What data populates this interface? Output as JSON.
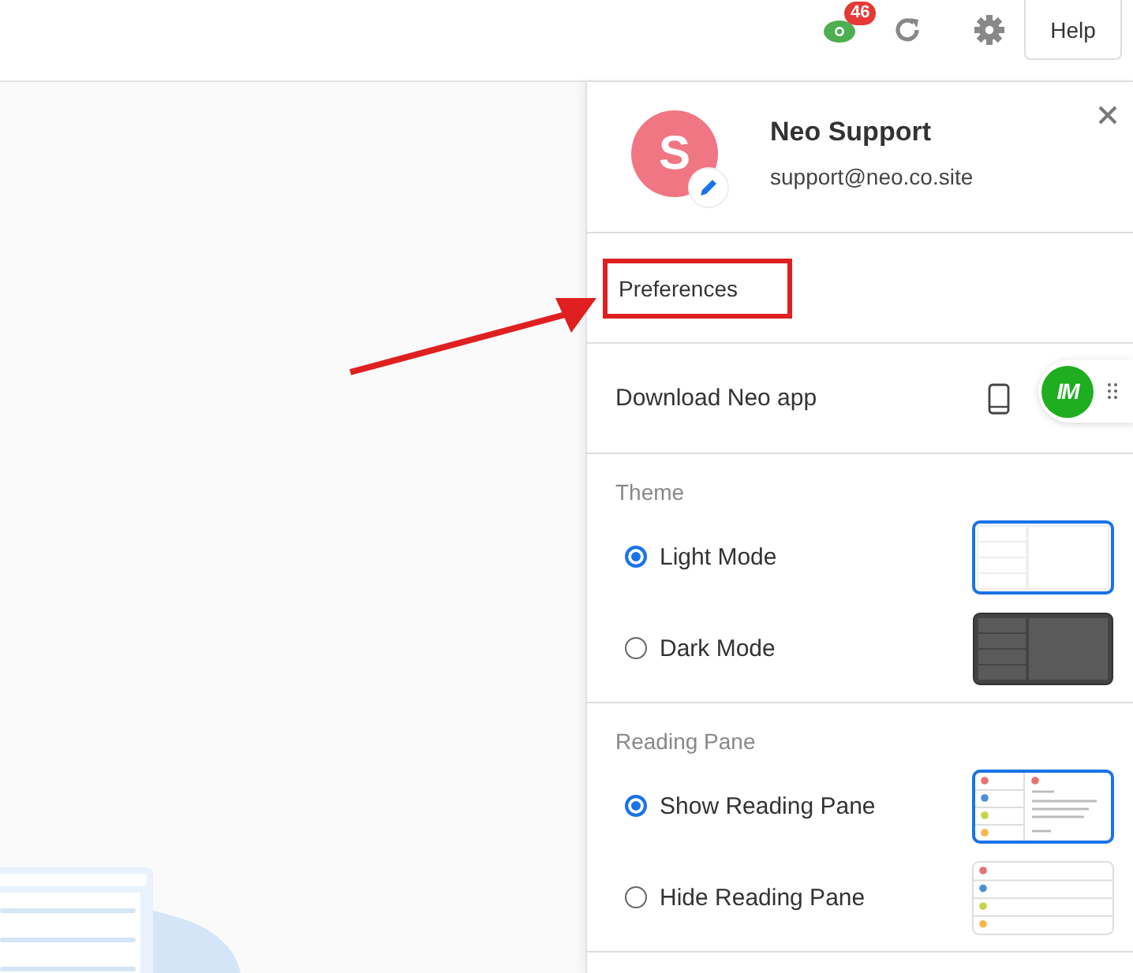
{
  "toolbar": {
    "notification_count": "46",
    "help_label": "Help"
  },
  "profile": {
    "avatar_letter": "S",
    "name": "Neo Support",
    "email": "support@neo.co.site"
  },
  "preferences": {
    "label": "Preferences",
    "highlighted": true
  },
  "download": {
    "label": "Download Neo app",
    "widget_logo": "IM"
  },
  "sections": [
    {
      "title": "Theme",
      "options": [
        {
          "label": "Light Mode",
          "selected": true,
          "kind": "light"
        },
        {
          "label": "Dark Mode",
          "selected": false,
          "kind": "dark"
        }
      ]
    },
    {
      "title": "Reading Pane",
      "options": [
        {
          "label": "Show Reading Pane",
          "selected": true,
          "kind": "pane"
        },
        {
          "label": "Hide Reading Pane",
          "selected": false,
          "kind": "list"
        }
      ]
    }
  ]
}
